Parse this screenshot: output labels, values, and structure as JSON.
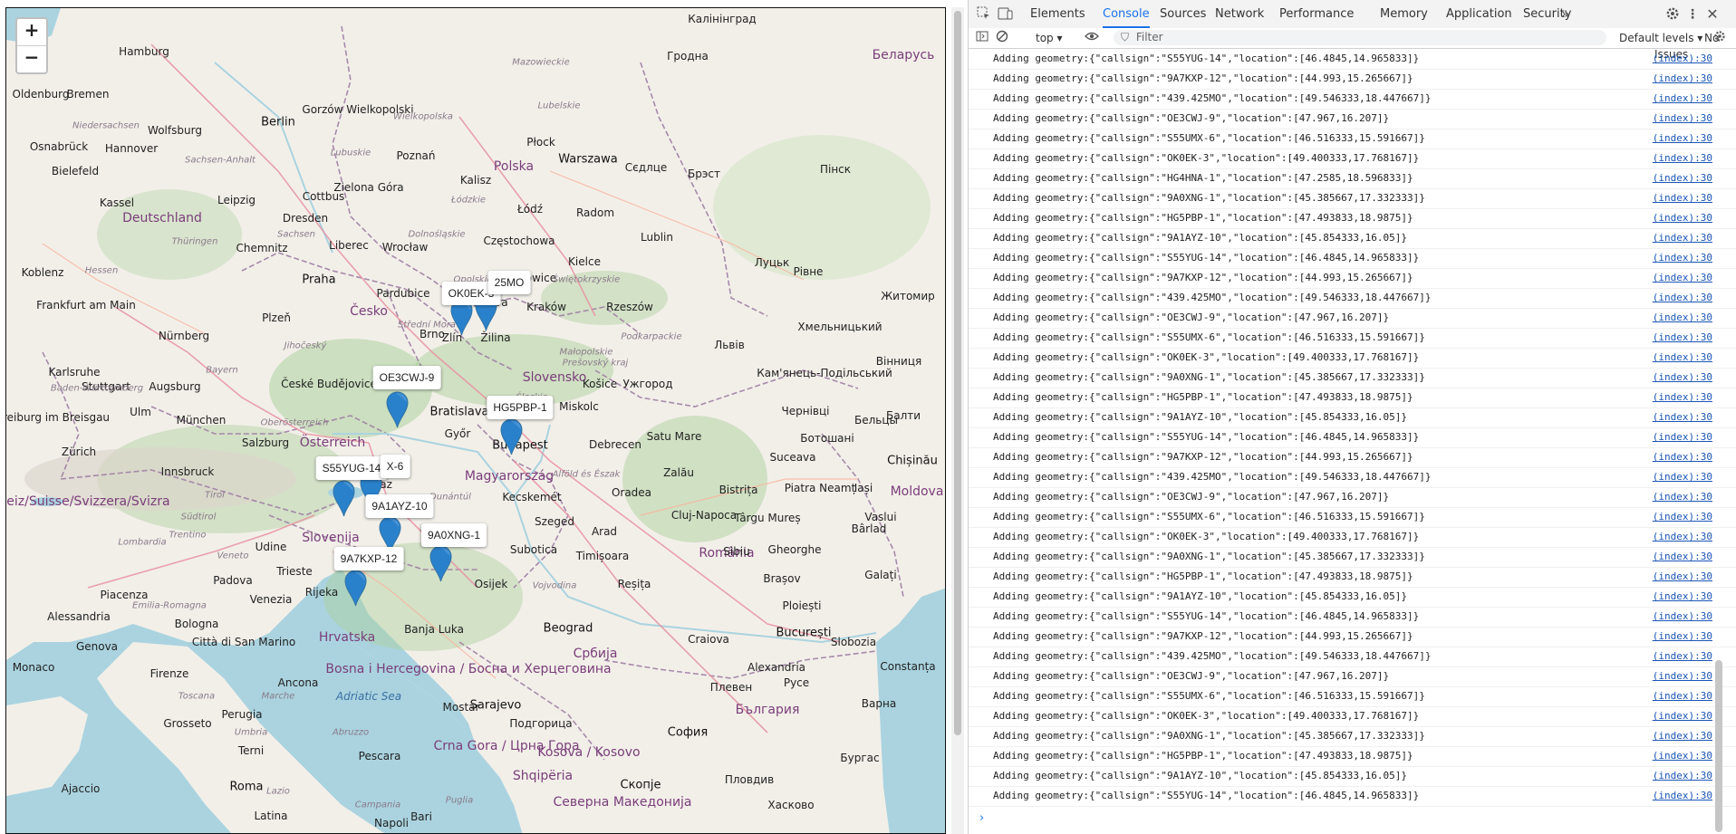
{
  "map": {
    "zoom_in": "+",
    "zoom_out": "−",
    "markers": [
      {
        "callsign": "OK0EK-3",
        "tip": "OK0EK-3"
      },
      {
        "callsign": "439.425MO",
        "tip": "25MO"
      },
      {
        "callsign": "OE3CWJ-9",
        "tip": "OE3CWJ-9"
      },
      {
        "callsign": "HG5PBP-1",
        "tip": "HG5PBP-1"
      },
      {
        "callsign": "S55YUG-14",
        "tip": "S55YUG-14"
      },
      {
        "callsign": "S55UMX-6",
        "tip": "X-6"
      },
      {
        "callsign": "9A1AYZ-10",
        "tip": "9A1AYZ-10"
      },
      {
        "callsign": "9A0XNG-1",
        "tip": "9A0XNG-1"
      },
      {
        "callsign": "9A7KXP-12",
        "tip": "9A7KXP-12"
      }
    ],
    "labels": [
      {
        "text": "Hamburg",
        "kind": "city"
      },
      {
        "text": "Bremen",
        "kind": "city"
      },
      {
        "text": "Berlin",
        "kind": "capital"
      },
      {
        "text": "Hannover",
        "kind": "city"
      },
      {
        "text": "Wolfsburg",
        "kind": "city"
      },
      {
        "text": "Bielefeld",
        "kind": "city"
      },
      {
        "text": "Kassel",
        "kind": "city"
      },
      {
        "text": "Leipzig",
        "kind": "city"
      },
      {
        "text": "Dresden",
        "kind": "city"
      },
      {
        "text": "Chemnitz",
        "kind": "city"
      },
      {
        "text": "Deutschland",
        "kind": "country"
      },
      {
        "text": "Frankfurt am Main",
        "kind": "city"
      },
      {
        "text": "Nürnberg",
        "kind": "city"
      },
      {
        "text": "Stuttgart",
        "kind": "city"
      },
      {
        "text": "München",
        "kind": "city"
      },
      {
        "text": "Augsburg",
        "kind": "city"
      },
      {
        "text": "Zürich",
        "kind": "city"
      },
      {
        "text": "Schweiz/Suisse/Svizzera/Svizra",
        "kind": "country"
      },
      {
        "text": "Praha",
        "kind": "capital"
      },
      {
        "text": "Česko",
        "kind": "country"
      },
      {
        "text": "Plzeň",
        "kind": "city"
      },
      {
        "text": "Pardubice",
        "kind": "city"
      },
      {
        "text": "Brno",
        "kind": "city"
      },
      {
        "text": "Zlín",
        "kind": "city"
      },
      {
        "text": "Žilina",
        "kind": "city"
      },
      {
        "text": "Ostrava",
        "kind": "city"
      },
      {
        "text": "Polska",
        "kind": "country"
      },
      {
        "text": "Warszawa",
        "kind": "capital"
      },
      {
        "text": "Łódź",
        "kind": "city"
      },
      {
        "text": "Poznań",
        "kind": "city"
      },
      {
        "text": "Wrocław",
        "kind": "city"
      },
      {
        "text": "Kraków",
        "kind": "city"
      },
      {
        "text": "Katowice",
        "kind": "city"
      },
      {
        "text": "Lublin",
        "kind": "city"
      },
      {
        "text": "Radom",
        "kind": "city"
      },
      {
        "text": "Rzeszów",
        "kind": "city"
      },
      {
        "text": "Częstochowa",
        "kind": "city"
      },
      {
        "text": "Slovensko",
        "kind": "country"
      },
      {
        "text": "Bratislava",
        "kind": "capital"
      },
      {
        "text": "Košice",
        "kind": "city"
      },
      {
        "text": "Miskolc",
        "kind": "city"
      },
      {
        "text": "Budapest",
        "kind": "capital"
      },
      {
        "text": "Magyarország",
        "kind": "country"
      },
      {
        "text": "Győr",
        "kind": "city"
      },
      {
        "text": "Debrecen",
        "kind": "city"
      },
      {
        "text": "Szeged",
        "kind": "city"
      },
      {
        "text": "Kecskemét",
        "kind": "city"
      },
      {
        "text": "Österreich",
        "kind": "country"
      },
      {
        "text": "Salzburg",
        "kind": "city"
      },
      {
        "text": "Graz",
        "kind": "city"
      },
      {
        "text": "Innsbruck",
        "kind": "city"
      },
      {
        "text": "Slovenija",
        "kind": "country"
      },
      {
        "text": "Hrvatska",
        "kind": "country"
      },
      {
        "text": "Rijeka",
        "kind": "city"
      },
      {
        "text": "Trieste",
        "kind": "city"
      },
      {
        "text": "Udine",
        "kind": "city"
      },
      {
        "text": "Padova",
        "kind": "city"
      },
      {
        "text": "Venezia",
        "kind": "city"
      },
      {
        "text": "Bologna",
        "kind": "city"
      },
      {
        "text": "Firenze",
        "kind": "city"
      },
      {
        "text": "Genova",
        "kind": "city"
      },
      {
        "text": "Monaco",
        "kind": "city"
      },
      {
        "text": "Roma",
        "kind": "capital"
      },
      {
        "text": "Perugia",
        "kind": "city"
      },
      {
        "text": "Ancona",
        "kind": "city"
      },
      {
        "text": "Pescara",
        "kind": "city"
      },
      {
        "text": "Città di San Marino",
        "kind": "city"
      },
      {
        "text": "Alessandria",
        "kind": "city"
      },
      {
        "text": "Piacenza",
        "kind": "city"
      },
      {
        "text": "Grosseto",
        "kind": "city"
      },
      {
        "text": "Terni",
        "kind": "city"
      },
      {
        "text": "Ajaccio",
        "kind": "city"
      },
      {
        "text": "Latina",
        "kind": "city"
      },
      {
        "text": "Napoli",
        "kind": "city"
      },
      {
        "text": "Bari",
        "kind": "city"
      },
      {
        "text": "Bosna i Hercegovina / Босна и Херцеговина",
        "kind": "country"
      },
      {
        "text": "Mostar",
        "kind": "city"
      },
      {
        "text": "Banja Luka",
        "kind": "city"
      },
      {
        "text": "Osijek",
        "kind": "city"
      },
      {
        "text": "Subotica",
        "kind": "city"
      },
      {
        "text": "Beograd",
        "kind": "capital"
      },
      {
        "text": "Србија",
        "kind": "country"
      },
      {
        "text": "Crna Gora / Црна Гора",
        "kind": "country"
      },
      {
        "text": "Kosova / Kosovo",
        "kind": "country"
      },
      {
        "text": "Shqipëria",
        "kind": "country"
      },
      {
        "text": "Северна Македонија",
        "kind": "country"
      },
      {
        "text": "Timișoara",
        "kind": "city"
      },
      {
        "text": "Cluj-Napoca",
        "kind": "city"
      },
      {
        "text": "Oradea",
        "kind": "city"
      },
      {
        "text": "Arad",
        "kind": "city"
      },
      {
        "text": "România",
        "kind": "country"
      },
      {
        "text": "București",
        "kind": "capital"
      },
      {
        "text": "Brașov",
        "kind": "city"
      },
      {
        "text": "Craiova",
        "kind": "city"
      },
      {
        "text": "Ploiești",
        "kind": "city"
      },
      {
        "text": "Constanța",
        "kind": "city"
      },
      {
        "text": "Iași",
        "kind": "city"
      },
      {
        "text": "Galați",
        "kind": "city"
      },
      {
        "text": "Suceava",
        "kind": "city"
      },
      {
        "text": "Chișinău",
        "kind": "capital"
      },
      {
        "text": "Moldova",
        "kind": "country"
      },
      {
        "text": "България",
        "kind": "country"
      },
      {
        "text": "София",
        "kind": "capital"
      },
      {
        "text": "Пловдив",
        "kind": "city"
      },
      {
        "text": "Варна",
        "kind": "city"
      },
      {
        "text": "Бургас",
        "kind": "city"
      },
      {
        "text": "Хасково",
        "kind": "city"
      },
      {
        "text": "Плевен",
        "kind": "city"
      },
      {
        "text": "Русе",
        "kind": "city"
      },
      {
        "text": "Скопје",
        "kind": "capital"
      },
      {
        "text": "Подгорица",
        "kind": "city"
      },
      {
        "text": "Беларусь",
        "kind": "country"
      },
      {
        "text": "Гродна",
        "kind": "city"
      },
      {
        "text": "Брэст",
        "kind": "city"
      },
      {
        "text": "Пінск",
        "kind": "city"
      },
      {
        "text": "Луцьк",
        "kind": "city"
      },
      {
        "text": "Рівне",
        "kind": "city"
      },
      {
        "text": "Житомир",
        "kind": "city"
      },
      {
        "text": "Львів",
        "kind": "city"
      },
      {
        "text": "Ужгород",
        "kind": "city"
      },
      {
        "text": "Хмельницький",
        "kind": "city"
      },
      {
        "text": "Вінниця",
        "kind": "city"
      },
      {
        "text": "Кам'янець-Подільський",
        "kind": "city"
      },
      {
        "text": "Чернівці",
        "kind": "city"
      },
      {
        "text": "Ботошані",
        "kind": "city"
      },
      {
        "text": "Балти",
        "kind": "city"
      },
      {
        "text": "Бельцы",
        "kind": "city"
      },
      {
        "text": "Сєдлце",
        "kind": "city"
      },
      {
        "text": "Калінінград",
        "kind": "city"
      },
      {
        "text": "Oldenburg",
        "kind": "city"
      },
      {
        "text": "Osnabrück",
        "kind": "city"
      },
      {
        "text": "Koblenz",
        "kind": "city"
      },
      {
        "text": "Karlsruhe",
        "kind": "city"
      },
      {
        "text": "Freiburg im Breisgau",
        "kind": "city"
      },
      {
        "text": "Ulm",
        "kind": "city"
      },
      {
        "text": "Cottbus",
        "kind": "city"
      },
      {
        "text": "Liberec",
        "kind": "city"
      },
      {
        "text": "České Budějovice",
        "kind": "city"
      },
      {
        "text": "Gorzów Wielkopolski",
        "kind": "city"
      },
      {
        "text": "Zielona Góra",
        "kind": "city"
      },
      {
        "text": "Kalisz",
        "kind": "city"
      },
      {
        "text": "Płock",
        "kind": "city"
      },
      {
        "text": "Kielce",
        "kind": "city"
      },
      {
        "text": "Sarajevo",
        "kind": "capital"
      },
      {
        "text": "Bistrița",
        "kind": "city"
      },
      {
        "text": "Târgu Mureș",
        "kind": "city"
      },
      {
        "text": "Sibiu",
        "kind": "city"
      },
      {
        "text": "Reșița",
        "kind": "city"
      },
      {
        "text": "Alexandria",
        "kind": "city"
      },
      {
        "text": "Slobozia",
        "kind": "city"
      },
      {
        "text": "Piatra Neamț",
        "kind": "city"
      },
      {
        "text": "Vaslui",
        "kind": "city"
      },
      {
        "text": "Bârlad",
        "kind": "city"
      },
      {
        "text": "Gheorghe",
        "kind": "city"
      },
      {
        "text": "Satu Mare",
        "kind": "city"
      },
      {
        "text": "Zalău",
        "kind": "city"
      },
      {
        "text": "Vojvodina",
        "kind": "region"
      },
      {
        "text": "Südtirol",
        "kind": "region"
      },
      {
        "text": "Bayern",
        "kind": "region"
      },
      {
        "text": "Hessen",
        "kind": "region"
      },
      {
        "text": "Thüringen",
        "kind": "region"
      },
      {
        "text": "Sachsen",
        "kind": "region"
      },
      {
        "text": "Sachsen-Anhalt",
        "kind": "region"
      },
      {
        "text": "Niedersachsen",
        "kind": "region"
      },
      {
        "text": "Baden-Württemberg",
        "kind": "region"
      },
      {
        "text": "Oberösterreich",
        "kind": "region"
      },
      {
        "text": "Tirol",
        "kind": "region"
      },
      {
        "text": "Trentino",
        "kind": "region"
      },
      {
        "text": "Veneto",
        "kind": "region"
      },
      {
        "text": "Lombardia",
        "kind": "region"
      },
      {
        "text": "Toscana",
        "kind": "region"
      },
      {
        "text": "Lazio",
        "kind": "region"
      },
      {
        "text": "Abruzzo",
        "kind": "region"
      },
      {
        "text": "Campania",
        "kind": "region"
      },
      {
        "text": "Puglia",
        "kind": "region"
      },
      {
        "text": "Marche",
        "kind": "region"
      },
      {
        "text": "Umbria",
        "kind": "region"
      },
      {
        "text": "Emilia-Romagna",
        "kind": "region"
      },
      {
        "text": "Dunántúl",
        "kind": "region"
      },
      {
        "text": "Alföld és Észak",
        "kind": "region"
      },
      {
        "text": "Jihočeský",
        "kind": "region"
      },
      {
        "text": "Střední Morava",
        "kind": "region"
      },
      {
        "text": "Prešovský kraj",
        "kind": "region"
      },
      {
        "text": "Wielkopolska",
        "kind": "region"
      },
      {
        "text": "Mazowieckie",
        "kind": "region"
      },
      {
        "text": "Lubelskie",
        "kind": "region"
      },
      {
        "text": "Podkarpackie",
        "kind": "region"
      },
      {
        "text": "Małopolskie",
        "kind": "region"
      },
      {
        "text": "Śląskie",
        "kind": "region"
      },
      {
        "text": "Świętokrzyskie",
        "kind": "region"
      },
      {
        "text": "Łódzkie",
        "kind": "region"
      },
      {
        "text": "Opolskie",
        "kind": "region"
      },
      {
        "text": "Dolnośląskie",
        "kind": "region"
      },
      {
        "text": "Lubuskie",
        "kind": "region"
      },
      {
        "text": "Adriatic Sea",
        "kind": "sea"
      }
    ]
  },
  "devtools": {
    "tabs": [
      "Elements",
      "Console",
      "Sources",
      "Network",
      "Performance",
      "Memory",
      "Application",
      "Security"
    ],
    "active_tab": "Console",
    "more_tabs": "»",
    "context": "top",
    "filter_placeholder": "Filter",
    "levels": "Default levels",
    "issues": "No Issues",
    "console_lines": [
      "Adding geometry:{\"callsign\":\"S55YUG-14\",\"location\":[46.4845,14.965833]}",
      "Adding geometry:{\"callsign\":\"9A7KXP-12\",\"location\":[44.993,15.265667]}",
      "Adding geometry:{\"callsign\":\"439.425MO\",\"location\":[49.546333,18.447667]}",
      "Adding geometry:{\"callsign\":\"OE3CWJ-9\",\"location\":[47.967,16.207]}",
      "Adding geometry:{\"callsign\":\"S55UMX-6\",\"location\":[46.516333,15.591667]}",
      "Adding geometry:{\"callsign\":\"OK0EK-3\",\"location\":[49.400333,17.768167]}",
      "Adding geometry:{\"callsign\":\"HG4HNA-1\",\"location\":[47.2585,18.596833]}",
      "Adding geometry:{\"callsign\":\"9A0XNG-1\",\"location\":[45.385667,17.332333]}",
      "Adding geometry:{\"callsign\":\"HG5PBP-1\",\"location\":[47.493833,18.9875]}",
      "Adding geometry:{\"callsign\":\"9A1AYZ-10\",\"location\":[45.854333,16.05]}",
      "Adding geometry:{\"callsign\":\"S55YUG-14\",\"location\":[46.4845,14.965833]}",
      "Adding geometry:{\"callsign\":\"9A7KXP-12\",\"location\":[44.993,15.265667]}",
      "Adding geometry:{\"callsign\":\"439.425MO\",\"location\":[49.546333,18.447667]}",
      "Adding geometry:{\"callsign\":\"OE3CWJ-9\",\"location\":[47.967,16.207]}",
      "Adding geometry:{\"callsign\":\"S55UMX-6\",\"location\":[46.516333,15.591667]}",
      "Adding geometry:{\"callsign\":\"OK0EK-3\",\"location\":[49.400333,17.768167]}",
      "Adding geometry:{\"callsign\":\"9A0XNG-1\",\"location\":[45.385667,17.332333]}",
      "Adding geometry:{\"callsign\":\"HG5PBP-1\",\"location\":[47.493833,18.9875]}",
      "Adding geometry:{\"callsign\":\"9A1AYZ-10\",\"location\":[45.854333,16.05]}",
      "Adding geometry:{\"callsign\":\"S55YUG-14\",\"location\":[46.4845,14.965833]}",
      "Adding geometry:{\"callsign\":\"9A7KXP-12\",\"location\":[44.993,15.265667]}",
      "Adding geometry:{\"callsign\":\"439.425MO\",\"location\":[49.546333,18.447667]}",
      "Adding geometry:{\"callsign\":\"OE3CWJ-9\",\"location\":[47.967,16.207]}",
      "Adding geometry:{\"callsign\":\"S55UMX-6\",\"location\":[46.516333,15.591667]}",
      "Adding geometry:{\"callsign\":\"OK0EK-3\",\"location\":[49.400333,17.768167]}",
      "Adding geometry:{\"callsign\":\"9A0XNG-1\",\"location\":[45.385667,17.332333]}",
      "Adding geometry:{\"callsign\":\"HG5PBP-1\",\"location\":[47.493833,18.9875]}",
      "Adding geometry:{\"callsign\":\"9A1AYZ-10\",\"location\":[45.854333,16.05]}",
      "Adding geometry:{\"callsign\":\"S55YUG-14\",\"location\":[46.4845,14.965833]}",
      "Adding geometry:{\"callsign\":\"9A7KXP-12\",\"location\":[44.993,15.265667]}",
      "Adding geometry:{\"callsign\":\"439.425MO\",\"location\":[49.546333,18.447667]}",
      "Adding geometry:{\"callsign\":\"OE3CWJ-9\",\"location\":[47.967,16.207]}",
      "Adding geometry:{\"callsign\":\"S55UMX-6\",\"location\":[46.516333,15.591667]}",
      "Adding geometry:{\"callsign\":\"OK0EK-3\",\"location\":[49.400333,17.768167]}",
      "Adding geometry:{\"callsign\":\"9A0XNG-1\",\"location\":[45.385667,17.332333]}",
      "Adding geometry:{\"callsign\":\"HG5PBP-1\",\"location\":[47.493833,18.9875]}",
      "Adding geometry:{\"callsign\":\"9A1AYZ-10\",\"location\":[45.854333,16.05]}",
      "Adding geometry:{\"callsign\":\"S55YUG-14\",\"location\":[46.4845,14.965833]}"
    ],
    "source_link": "(index):30",
    "prompt": "›"
  },
  "colors": {
    "accent": "#1a73e8",
    "marker": "#2a81cb",
    "sea": "#aad3df",
    "land": "#f2efe9",
    "forest": "#add19e",
    "border": "#9e7fa3"
  }
}
